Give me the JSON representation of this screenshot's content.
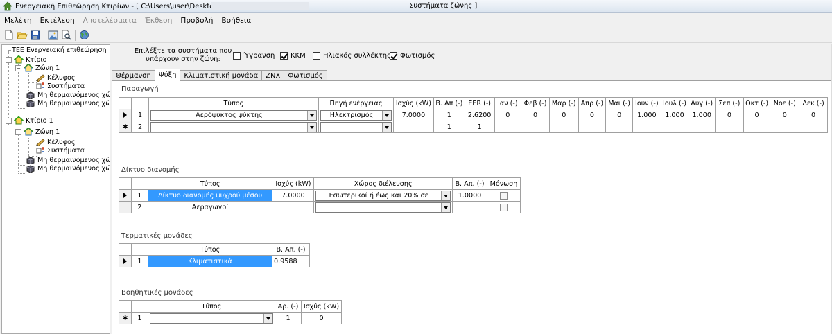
{
  "window": {
    "title": "Ενεργειακή Επιθεώρηση Κτιρίων - [ C:\\Users\\user\\Desktop",
    "title_tail": "Συστήματα ζώνης ]"
  },
  "menu": [
    {
      "ul": "Μ",
      "rest": "ελέτη",
      "disabled": false
    },
    {
      "ul": "Ε",
      "rest": "κτέλεση",
      "disabled": false
    },
    {
      "ul": "Α",
      "rest": "ποτελέσματα",
      "disabled": true
    },
    {
      "ul": "Έ",
      "rest": "κθεση",
      "disabled": true
    },
    {
      "ul": "Π",
      "rest": "ροβολή",
      "disabled": false
    },
    {
      "ul": "Β",
      "rest": "οήθεια",
      "disabled": false
    }
  ],
  "toolbar": {
    "icons": [
      "new-file-icon",
      "open-folder-icon",
      "save-icon",
      "image-icon",
      "print-preview-icon",
      "globe-icon"
    ]
  },
  "tree": {
    "root": "ΤΕΕ Ενεργειακή επιθεώρηση",
    "building1": "Κτίριο",
    "zone1": "Ζώνη 1",
    "envelope1": "Κέλυφος",
    "systems1": "Συστήματα",
    "unheated1a": "Μη θερμαινόμενος χώ",
    "unheated1b": "Μη θερμαινόμενος χώ",
    "building2": "Κτίριο 1",
    "zone2": "Ζώνη 1",
    "envelope2": "Κέλυφος",
    "systems2": "Συστήματα",
    "unheated2a": "Μη θερμαινόμενος χώ",
    "unheated2b": "Μη θερμαινόμενος χώ"
  },
  "systems_select": {
    "label": "Επιλέξτε τα συστήματα που υπάρχουν στην ζώνη:",
    "options": [
      {
        "label": "Ύγρανση",
        "checked": false
      },
      {
        "label": "ΚΚΜ",
        "checked": true
      },
      {
        "label": "Ηλιακός συλλέκτης",
        "checked": false
      },
      {
        "label": "Φωτισμός",
        "checked": true
      }
    ]
  },
  "tabs": [
    "Θέρμανση",
    "Ψύξη",
    "Κλιματιστική μονάδα",
    "ΖΝΧ",
    "Φωτισμός"
  ],
  "active_tab": "Ψύξη",
  "production": {
    "title": "Παραγωγή",
    "headers": {
      "type": "Τύπος",
      "source": "Πηγή ενέργειας",
      "power": "Ισχύς (kW)",
      "share": "Β. Απ (-)",
      "eer": "EER (-)",
      "months": [
        "Ιαν (-)",
        "Φεβ (-)",
        "Μαρ (-)",
        "Απρ (-)",
        "Μαι (-)",
        "Ιουν (-)",
        "Ιουλ (-)",
        "Αυγ (-)",
        "Σεπ (-)",
        "Οκτ (-)",
        "Νοε (-)",
        "Δεκ (-)"
      ]
    },
    "rows": [
      {
        "num": "1",
        "type": "Αερόψυκτος ψύκτης",
        "source": "Ηλεκτρισμός",
        "power": "7.0000",
        "share": "1",
        "eer": "2.6200",
        "months": [
          "0",
          "0",
          "0",
          "0",
          "0",
          "1.000",
          "1.000",
          "1.000",
          "0",
          "0",
          "0",
          "0"
        ]
      },
      {
        "num": "2",
        "type": "",
        "source": "",
        "power": "",
        "share": "1",
        "eer": "1",
        "months": [
          "",
          "",
          "",
          "",
          "",
          "",
          "",
          "",
          "",
          "",
          "",
          ""
        ]
      }
    ]
  },
  "distribution": {
    "title": "Δίκτυο διανομής",
    "headers": {
      "type": "Τύπος",
      "power": "Ισχύς (kW)",
      "space": "Χώρος διέλευσης",
      "share": "Β. Απ. (-)",
      "insulation": "Μόνωση"
    },
    "rows": [
      {
        "num": "1",
        "type": "Δίκτυο διανομής ψυχρού μέσου",
        "power": "7.0000",
        "space": "Εσωτερικοί ή έως και 20% σε",
        "share": "1.0000"
      },
      {
        "num": "2",
        "type": "Αεραγωγοί",
        "power": "",
        "space": "",
        "share": ""
      }
    ]
  },
  "terminal": {
    "title": "Τερματικές μονάδες",
    "headers": {
      "type": "Τύπος",
      "share": "Β. Απ. (-)"
    },
    "rows": [
      {
        "num": "1",
        "type": "Κλιματιστικά",
        "share": "0.9588"
      }
    ]
  },
  "auxiliary": {
    "title": "Βοηθητικές μονάδες",
    "headers": {
      "type": "Τύπος",
      "count": "Αρ. (-)",
      "power": "Ισχύς (kW)"
    },
    "rows": [
      {
        "num": "1",
        "type": "",
        "count": "1",
        "power": "0"
      }
    ]
  }
}
